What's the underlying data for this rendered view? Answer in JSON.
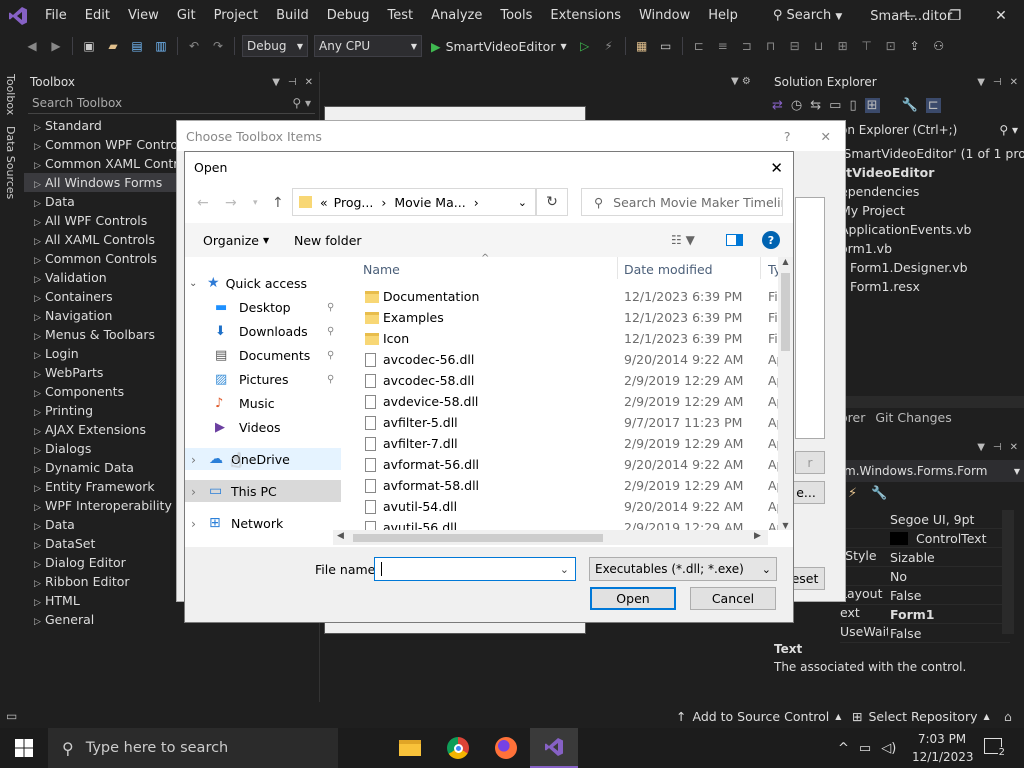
{
  "menubar": {
    "items": [
      "File",
      "Edit",
      "View",
      "Git",
      "Project",
      "Build",
      "Debug",
      "Test",
      "Analyze",
      "Tools",
      "Extensions",
      "Window",
      "Help"
    ],
    "search_label": "Search",
    "window_title": "Smart...ditor"
  },
  "toolbar": {
    "config": "Debug",
    "platform": "Any CPU",
    "start_target": "SmartVideoEditor"
  },
  "side_tabs": [
    "Toolbox",
    "Data Sources"
  ],
  "toolbox": {
    "title": "Toolbox",
    "search_placeholder": "Search Toolbox",
    "categories": [
      "Standard",
      "Common WPF Controls",
      "Common XAML Controls",
      "All Windows Forms",
      "Data",
      "All WPF Controls",
      "All XAML Controls",
      "Common Controls",
      "Validation",
      "Containers",
      "Navigation",
      "Menus & Toolbars",
      "Login",
      "WebParts",
      "Components",
      "Printing",
      "AJAX Extensions",
      "Dialogs",
      "Dynamic Data",
      "Entity Framework",
      "WPF Interoperability",
      "Data",
      "DataSet",
      "Dialog Editor",
      "Ribbon Editor",
      "HTML",
      "General"
    ]
  },
  "solution_explorer": {
    "title": "Solution Explorer",
    "search": "on Explorer (Ctrl+;)",
    "items": [
      "'SmartVideoEditor' (1 of 1 projec",
      "rtVideoEditor",
      "ependencies",
      "My Project",
      "ApplicationEvents.vb",
      "orm1.vb",
      "Form1.Designer.vb",
      "Form1.resx"
    ],
    "tabs": [
      "orer",
      "Git Changes"
    ]
  },
  "properties": {
    "type": "m.Windows.Forms.Form",
    "rows": [
      {
        "name": "",
        "value": "Segoe UI, 9pt"
      },
      {
        "name": "",
        "value": "ControlText"
      },
      {
        "name": "rStyle",
        "value": "Sizable"
      },
      {
        "name": "",
        "value": "No"
      },
      {
        "name": "Layout",
        "value": "False"
      },
      {
        "name": "ext",
        "value": "Form1"
      },
      {
        "name": "UseWaitCursor",
        "value": "False"
      }
    ],
    "desc_title": "Text",
    "desc_text": "The associated with the control."
  },
  "choose_dialog": {
    "title": "Choose Toolbox Items",
    "help": "?",
    "reset": "eset",
    "browse": "e..."
  },
  "open_dialog": {
    "title": "Open",
    "path": [
      "Prog...",
      "Movie Ma..."
    ],
    "search_placeholder": "Search Movie Maker Timelin...",
    "organize": "Organize",
    "new_folder": "New folder",
    "nav": {
      "quick_access": "Quick access",
      "pinned": [
        "Desktop",
        "Downloads",
        "Documents",
        "Pictures"
      ],
      "others": [
        "Music",
        "Videos"
      ],
      "onedrive": "OneDrive",
      "this_pc": "This PC",
      "network": "Network"
    },
    "columns": {
      "name": "Name",
      "date": "Date modified",
      "type": "Ty"
    },
    "files": [
      {
        "name": "Documentation",
        "date": "12/1/2023 6:39 PM",
        "type": "Fi",
        "kind": "folder"
      },
      {
        "name": "Examples",
        "date": "12/1/2023 6:39 PM",
        "type": "Fi",
        "kind": "folder"
      },
      {
        "name": "Icon",
        "date": "12/1/2023 6:39 PM",
        "type": "Fi",
        "kind": "folder"
      },
      {
        "name": "avcodec-56.dll",
        "date": "9/20/2014 9:22 AM",
        "type": "Ap",
        "kind": "dll"
      },
      {
        "name": "avcodec-58.dll",
        "date": "2/9/2019 12:29 AM",
        "type": "Ap",
        "kind": "dll"
      },
      {
        "name": "avdevice-58.dll",
        "date": "2/9/2019 12:29 AM",
        "type": "Ap",
        "kind": "dll"
      },
      {
        "name": "avfilter-5.dll",
        "date": "9/7/2017 11:23 PM",
        "type": "Ap",
        "kind": "dll"
      },
      {
        "name": "avfilter-7.dll",
        "date": "2/9/2019 12:29 AM",
        "type": "Ap",
        "kind": "dll"
      },
      {
        "name": "avformat-56.dll",
        "date": "9/20/2014 9:22 AM",
        "type": "Ap",
        "kind": "dll"
      },
      {
        "name": "avformat-58.dll",
        "date": "2/9/2019 12:29 AM",
        "type": "Ap",
        "kind": "dll"
      },
      {
        "name": "avutil-54.dll",
        "date": "9/20/2014 9:22 AM",
        "type": "Ap",
        "kind": "dll"
      },
      {
        "name": "avutil-56.dll",
        "date": "2/9/2019 12:29 AM",
        "type": "Ap",
        "kind": "dll"
      }
    ],
    "file_name_label": "File name:",
    "file_name_value": "",
    "filter": "Executables (*.dll; *.exe)",
    "open_button": "Open",
    "cancel_button": "Cancel"
  },
  "statusbar": {
    "source_control": "Add to Source Control",
    "repository": "Select Repository"
  },
  "taskbar": {
    "search_placeholder": "Type here to search",
    "time": "7:03 PM",
    "date": "12/1/2023",
    "notifications": "2"
  },
  "colors": {
    "vs_purple": "#8661c5",
    "dialog_bg": "#f0f0f0",
    "folder_yellow": "#f8d775",
    "selection_blue": "#cce8ff",
    "link_blue": "#0078d7"
  }
}
